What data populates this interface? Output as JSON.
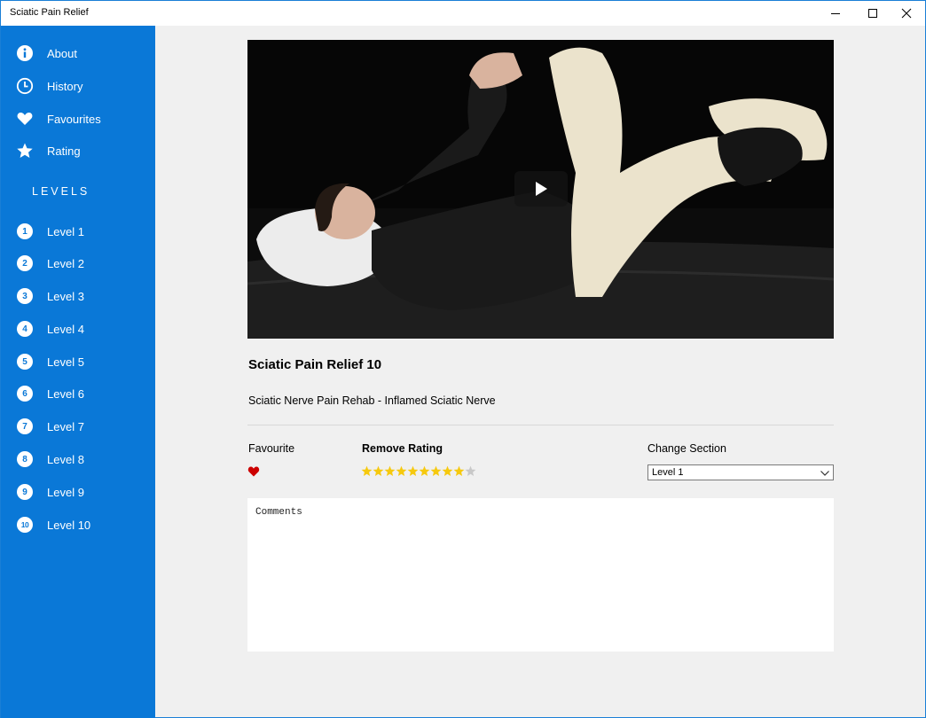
{
  "window": {
    "title": "Sciatic Pain Relief"
  },
  "sidebar": {
    "items": [
      {
        "label": "About",
        "icon": "info-icon"
      },
      {
        "label": "History",
        "icon": "clock-icon"
      },
      {
        "label": "Favourites",
        "icon": "heart-icon"
      },
      {
        "label": "Rating",
        "icon": "star-icon"
      }
    ],
    "levels_heading": "LEVELS",
    "levels": [
      {
        "number": "1",
        "label": "Level 1"
      },
      {
        "number": "2",
        "label": "Level 2"
      },
      {
        "number": "3",
        "label": "Level 3"
      },
      {
        "number": "4",
        "label": "Level 4"
      },
      {
        "number": "5",
        "label": "Level 5"
      },
      {
        "number": "6",
        "label": "Level 6"
      },
      {
        "number": "7",
        "label": "Level 7"
      },
      {
        "number": "8",
        "label": "Level 8"
      },
      {
        "number": "9",
        "label": "Level 9"
      },
      {
        "number": "10",
        "label": "Level 10"
      }
    ]
  },
  "main": {
    "title": "Sciatic Pain Relief 10",
    "subtitle": "Sciatic Nerve Pain Rehab - Inflamed Sciatic Nerve",
    "favourite_label": "Favourite",
    "favourited": true,
    "rating_label": "Remove Rating",
    "rating": {
      "value": 9,
      "max": 10
    },
    "section_label": "Change Section",
    "section_value": "Level 1",
    "comments_placeholder": "Comments"
  },
  "colors": {
    "sidebar": "#0a78d7",
    "star_filled": "#f6c90e",
    "star_empty": "#c8c8c8",
    "heart": "#cc0000"
  }
}
